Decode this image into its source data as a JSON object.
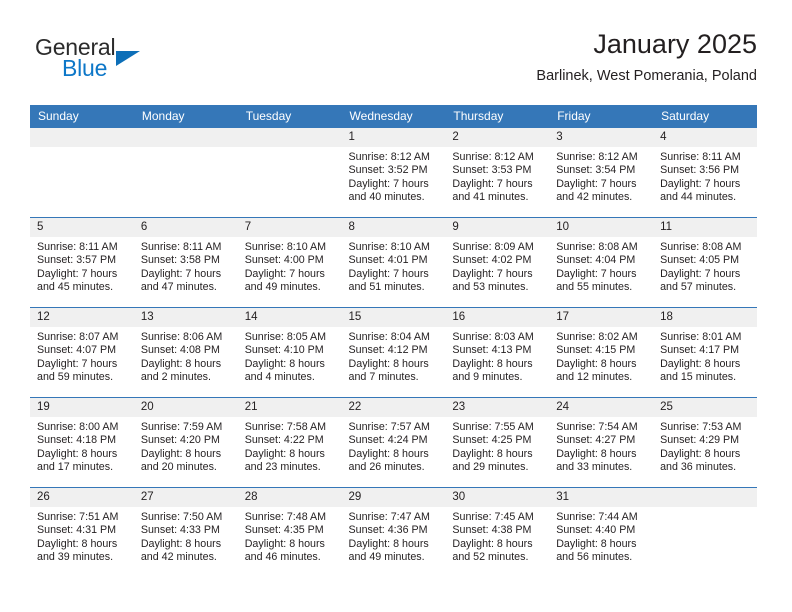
{
  "logo": {
    "word_top": "General",
    "word_bottom": "Blue",
    "triangle_color": "#0d6fb8",
    "blue_color": "#0d77c8"
  },
  "header": {
    "title": "January 2025",
    "subtitle": "Barlinek, West Pomerania, Poland"
  },
  "theme": {
    "header_blue": "#3577b8",
    "daynum_gray": "#f0f0f0",
    "text": "#231f20"
  },
  "weekdays": [
    "Sunday",
    "Monday",
    "Tuesday",
    "Wednesday",
    "Thursday",
    "Friday",
    "Saturday"
  ],
  "weeks": [
    [
      {
        "day": "",
        "sunrise": "",
        "sunset": "",
        "daylight1": "",
        "daylight2": ""
      },
      {
        "day": "",
        "sunrise": "",
        "sunset": "",
        "daylight1": "",
        "daylight2": ""
      },
      {
        "day": "",
        "sunrise": "",
        "sunset": "",
        "daylight1": "",
        "daylight2": ""
      },
      {
        "day": "1",
        "sunrise": "Sunrise: 8:12 AM",
        "sunset": "Sunset: 3:52 PM",
        "daylight1": "Daylight: 7 hours",
        "daylight2": "and 40 minutes."
      },
      {
        "day": "2",
        "sunrise": "Sunrise: 8:12 AM",
        "sunset": "Sunset: 3:53 PM",
        "daylight1": "Daylight: 7 hours",
        "daylight2": "and 41 minutes."
      },
      {
        "day": "3",
        "sunrise": "Sunrise: 8:12 AM",
        "sunset": "Sunset: 3:54 PM",
        "daylight1": "Daylight: 7 hours",
        "daylight2": "and 42 minutes."
      },
      {
        "day": "4",
        "sunrise": "Sunrise: 8:11 AM",
        "sunset": "Sunset: 3:56 PM",
        "daylight1": "Daylight: 7 hours",
        "daylight2": "and 44 minutes."
      }
    ],
    [
      {
        "day": "5",
        "sunrise": "Sunrise: 8:11 AM",
        "sunset": "Sunset: 3:57 PM",
        "daylight1": "Daylight: 7 hours",
        "daylight2": "and 45 minutes."
      },
      {
        "day": "6",
        "sunrise": "Sunrise: 8:11 AM",
        "sunset": "Sunset: 3:58 PM",
        "daylight1": "Daylight: 7 hours",
        "daylight2": "and 47 minutes."
      },
      {
        "day": "7",
        "sunrise": "Sunrise: 8:10 AM",
        "sunset": "Sunset: 4:00 PM",
        "daylight1": "Daylight: 7 hours",
        "daylight2": "and 49 minutes."
      },
      {
        "day": "8",
        "sunrise": "Sunrise: 8:10 AM",
        "sunset": "Sunset: 4:01 PM",
        "daylight1": "Daylight: 7 hours",
        "daylight2": "and 51 minutes."
      },
      {
        "day": "9",
        "sunrise": "Sunrise: 8:09 AM",
        "sunset": "Sunset: 4:02 PM",
        "daylight1": "Daylight: 7 hours",
        "daylight2": "and 53 minutes."
      },
      {
        "day": "10",
        "sunrise": "Sunrise: 8:08 AM",
        "sunset": "Sunset: 4:04 PM",
        "daylight1": "Daylight: 7 hours",
        "daylight2": "and 55 minutes."
      },
      {
        "day": "11",
        "sunrise": "Sunrise: 8:08 AM",
        "sunset": "Sunset: 4:05 PM",
        "daylight1": "Daylight: 7 hours",
        "daylight2": "and 57 minutes."
      }
    ],
    [
      {
        "day": "12",
        "sunrise": "Sunrise: 8:07 AM",
        "sunset": "Sunset: 4:07 PM",
        "daylight1": "Daylight: 7 hours",
        "daylight2": "and 59 minutes."
      },
      {
        "day": "13",
        "sunrise": "Sunrise: 8:06 AM",
        "sunset": "Sunset: 4:08 PM",
        "daylight1": "Daylight: 8 hours",
        "daylight2": "and 2 minutes."
      },
      {
        "day": "14",
        "sunrise": "Sunrise: 8:05 AM",
        "sunset": "Sunset: 4:10 PM",
        "daylight1": "Daylight: 8 hours",
        "daylight2": "and 4 minutes."
      },
      {
        "day": "15",
        "sunrise": "Sunrise: 8:04 AM",
        "sunset": "Sunset: 4:12 PM",
        "daylight1": "Daylight: 8 hours",
        "daylight2": "and 7 minutes."
      },
      {
        "day": "16",
        "sunrise": "Sunrise: 8:03 AM",
        "sunset": "Sunset: 4:13 PM",
        "daylight1": "Daylight: 8 hours",
        "daylight2": "and 9 minutes."
      },
      {
        "day": "17",
        "sunrise": "Sunrise: 8:02 AM",
        "sunset": "Sunset: 4:15 PM",
        "daylight1": "Daylight: 8 hours",
        "daylight2": "and 12 minutes."
      },
      {
        "day": "18",
        "sunrise": "Sunrise: 8:01 AM",
        "sunset": "Sunset: 4:17 PM",
        "daylight1": "Daylight: 8 hours",
        "daylight2": "and 15 minutes."
      }
    ],
    [
      {
        "day": "19",
        "sunrise": "Sunrise: 8:00 AM",
        "sunset": "Sunset: 4:18 PM",
        "daylight1": "Daylight: 8 hours",
        "daylight2": "and 17 minutes."
      },
      {
        "day": "20",
        "sunrise": "Sunrise: 7:59 AM",
        "sunset": "Sunset: 4:20 PM",
        "daylight1": "Daylight: 8 hours",
        "daylight2": "and 20 minutes."
      },
      {
        "day": "21",
        "sunrise": "Sunrise: 7:58 AM",
        "sunset": "Sunset: 4:22 PM",
        "daylight1": "Daylight: 8 hours",
        "daylight2": "and 23 minutes."
      },
      {
        "day": "22",
        "sunrise": "Sunrise: 7:57 AM",
        "sunset": "Sunset: 4:24 PM",
        "daylight1": "Daylight: 8 hours",
        "daylight2": "and 26 minutes."
      },
      {
        "day": "23",
        "sunrise": "Sunrise: 7:55 AM",
        "sunset": "Sunset: 4:25 PM",
        "daylight1": "Daylight: 8 hours",
        "daylight2": "and 29 minutes."
      },
      {
        "day": "24",
        "sunrise": "Sunrise: 7:54 AM",
        "sunset": "Sunset: 4:27 PM",
        "daylight1": "Daylight: 8 hours",
        "daylight2": "and 33 minutes."
      },
      {
        "day": "25",
        "sunrise": "Sunrise: 7:53 AM",
        "sunset": "Sunset: 4:29 PM",
        "daylight1": "Daylight: 8 hours",
        "daylight2": "and 36 minutes."
      }
    ],
    [
      {
        "day": "26",
        "sunrise": "Sunrise: 7:51 AM",
        "sunset": "Sunset: 4:31 PM",
        "daylight1": "Daylight: 8 hours",
        "daylight2": "and 39 minutes."
      },
      {
        "day": "27",
        "sunrise": "Sunrise: 7:50 AM",
        "sunset": "Sunset: 4:33 PM",
        "daylight1": "Daylight: 8 hours",
        "daylight2": "and 42 minutes."
      },
      {
        "day": "28",
        "sunrise": "Sunrise: 7:48 AM",
        "sunset": "Sunset: 4:35 PM",
        "daylight1": "Daylight: 8 hours",
        "daylight2": "and 46 minutes."
      },
      {
        "day": "29",
        "sunrise": "Sunrise: 7:47 AM",
        "sunset": "Sunset: 4:36 PM",
        "daylight1": "Daylight: 8 hours",
        "daylight2": "and 49 minutes."
      },
      {
        "day": "30",
        "sunrise": "Sunrise: 7:45 AM",
        "sunset": "Sunset: 4:38 PM",
        "daylight1": "Daylight: 8 hours",
        "daylight2": "and 52 minutes."
      },
      {
        "day": "31",
        "sunrise": "Sunrise: 7:44 AM",
        "sunset": "Sunset: 4:40 PM",
        "daylight1": "Daylight: 8 hours",
        "daylight2": "and 56 minutes."
      },
      {
        "day": "",
        "sunrise": "",
        "sunset": "",
        "daylight1": "",
        "daylight2": ""
      }
    ]
  ]
}
